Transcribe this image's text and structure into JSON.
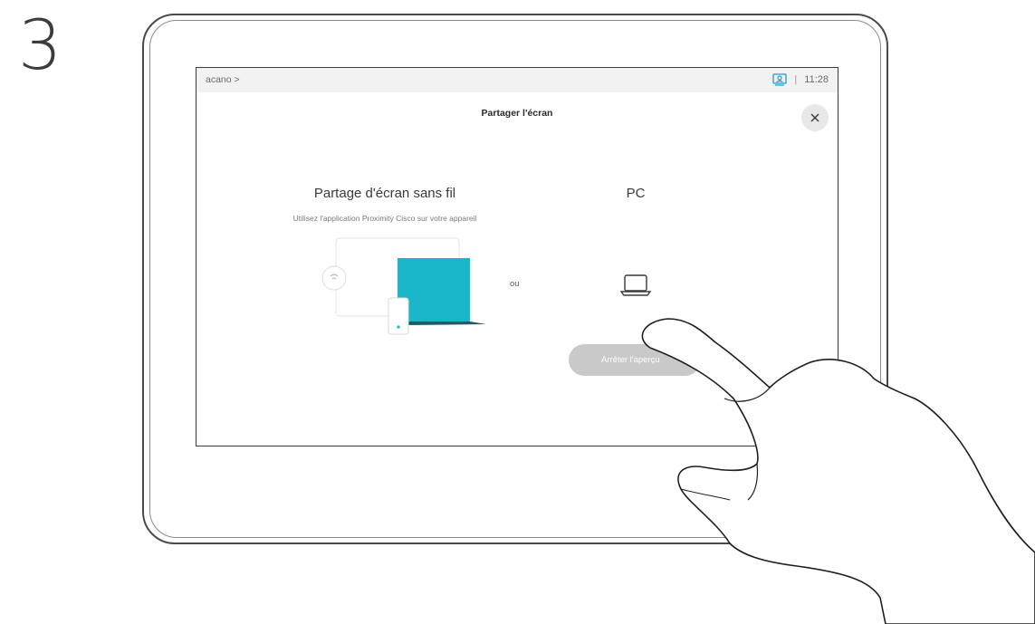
{
  "step": {
    "number": "3"
  },
  "status_bar": {
    "breadcrumb": "acano >",
    "separator": "|",
    "time": "11:28",
    "icons": {
      "user_icon": "person-in-frame-icon",
      "user_icon_color": "#1ba0d7"
    }
  },
  "dialog": {
    "title": "Partager l'écran",
    "close_icon": "close-icon"
  },
  "wireless": {
    "title": "Partage d'écran sans fil",
    "subtitle": "Utilisez l'application Proximity Cisco sur votre appareil",
    "illustration": "wireless-share-illustration",
    "accent_color": "#19b5c9"
  },
  "separator_label": "ou",
  "pc": {
    "title": "PC",
    "icon": "laptop-icon"
  },
  "stop_button": {
    "label": "Arrêter l'aperçu",
    "color": "#c9c9c9"
  },
  "overlay": {
    "hand": "pointing-hand-icon"
  }
}
